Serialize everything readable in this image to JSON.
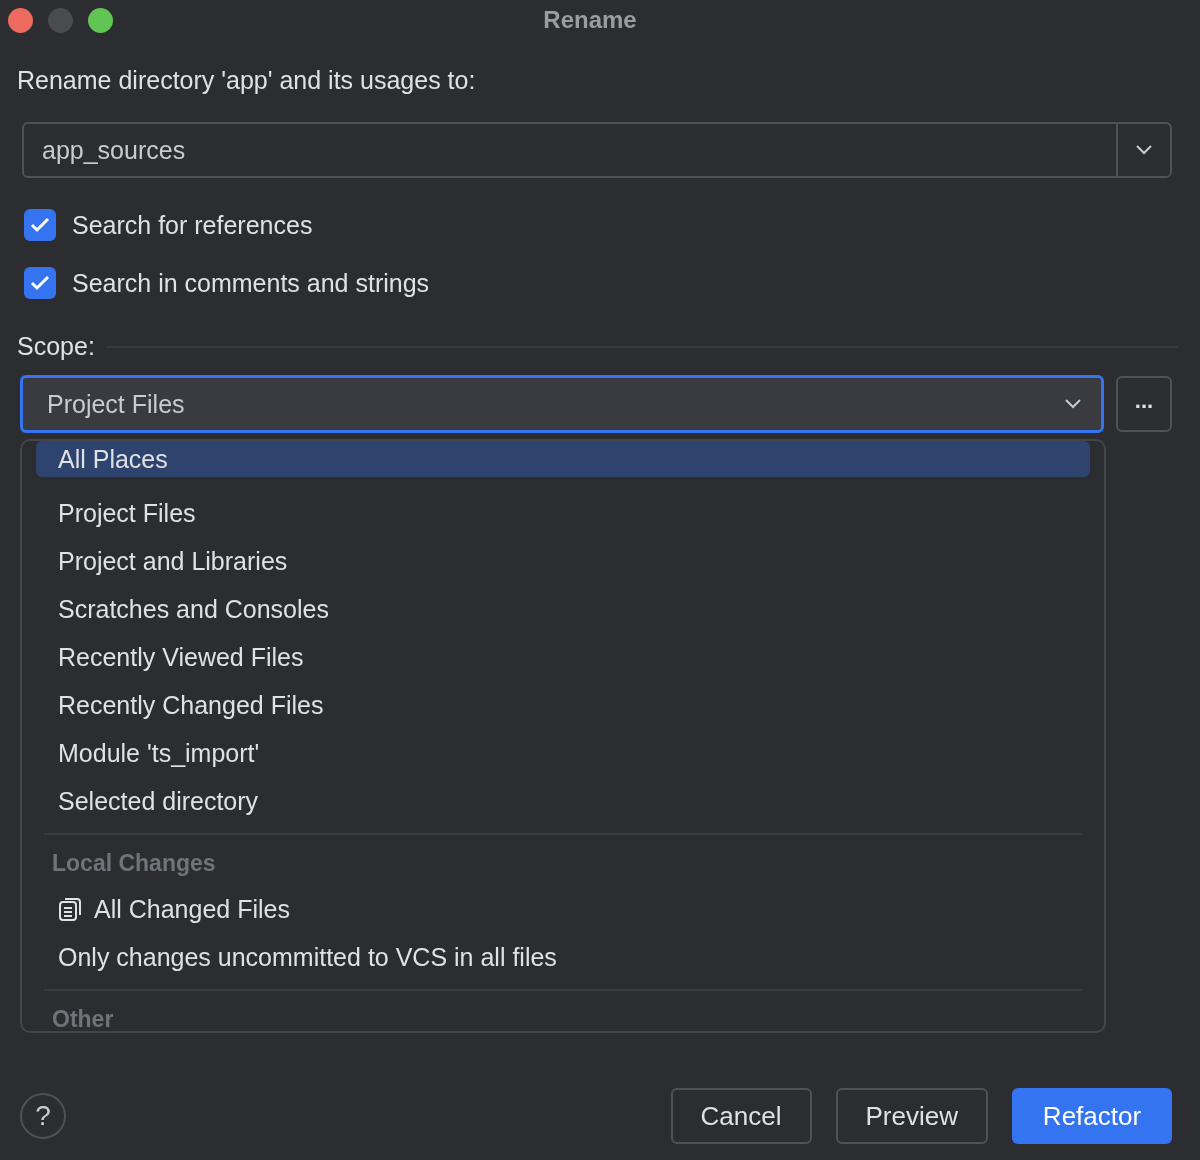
{
  "window": {
    "title": "Rename"
  },
  "prompt": "Rename directory 'app' and its usages to:",
  "name_field": {
    "value": "app_sources"
  },
  "checkboxes": [
    {
      "label": "Search for references",
      "checked": true
    },
    {
      "label": "Search in comments and strings",
      "checked": true
    }
  ],
  "scope": {
    "label": "Scope:",
    "value": "Project Files",
    "more_button": "...",
    "focused": true
  },
  "dropdown": {
    "sections": [
      {
        "items": [
          {
            "label": "All Places",
            "selected": true,
            "kind": "plain"
          },
          {
            "label": "Project Files",
            "selected": false,
            "kind": "plain"
          },
          {
            "label": "Project and Libraries",
            "selected": false,
            "kind": "plain"
          },
          {
            "label": "Scratches and Consoles",
            "selected": false,
            "kind": "plain"
          },
          {
            "label": "Recently Viewed Files",
            "selected": false,
            "kind": "plain"
          },
          {
            "label": "Recently Changed Files",
            "selected": false,
            "kind": "plain"
          },
          {
            "label": "Module 'ts_import'",
            "selected": false,
            "kind": "plain"
          },
          {
            "label": "Selected directory",
            "selected": false,
            "kind": "plain"
          }
        ]
      },
      {
        "header": "Local Changes",
        "items": [
          {
            "label": "All Changed Files",
            "selected": false,
            "kind": "changelist"
          },
          {
            "label": "Only changes uncommitted to VCS in all files",
            "selected": false,
            "kind": "plain"
          }
        ]
      },
      {
        "header": "Other"
      }
    ]
  },
  "help_button": "?",
  "buttons": [
    {
      "label": "Cancel",
      "kind": "secondary"
    },
    {
      "label": "Preview",
      "kind": "secondary"
    },
    {
      "label": "Refactor",
      "kind": "primary"
    }
  ]
}
